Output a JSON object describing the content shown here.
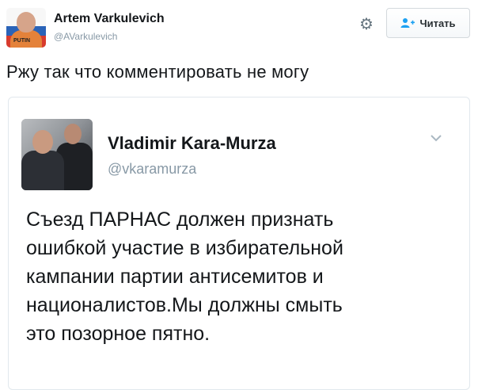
{
  "author": {
    "name": "Artem Varkulevich",
    "handle": "@AVarkulevich",
    "avatar_label": "PUTIN"
  },
  "actions": {
    "settings_icon": "gear-icon",
    "follow_icon": "follow-user-icon",
    "follow_label": "Читать"
  },
  "tweet": {
    "text": "Ржу так что комментировать не могу"
  },
  "quoted": {
    "name": "Vladimir Kara-Murza",
    "handle": "@vkaramurza",
    "more_icon": "chevron-down-icon",
    "text": "Съезд ПАРНАС должен признать\nошибкой участие в избирательной\nкампании партии антисемитов и\nнационалистов.Мы должны смыть\nэто позорное пятно."
  },
  "colors": {
    "primary_text": "#14171a",
    "secondary_text": "#8899a6",
    "follow_accent": "#1da1f2",
    "border": "#e1e8ed"
  }
}
